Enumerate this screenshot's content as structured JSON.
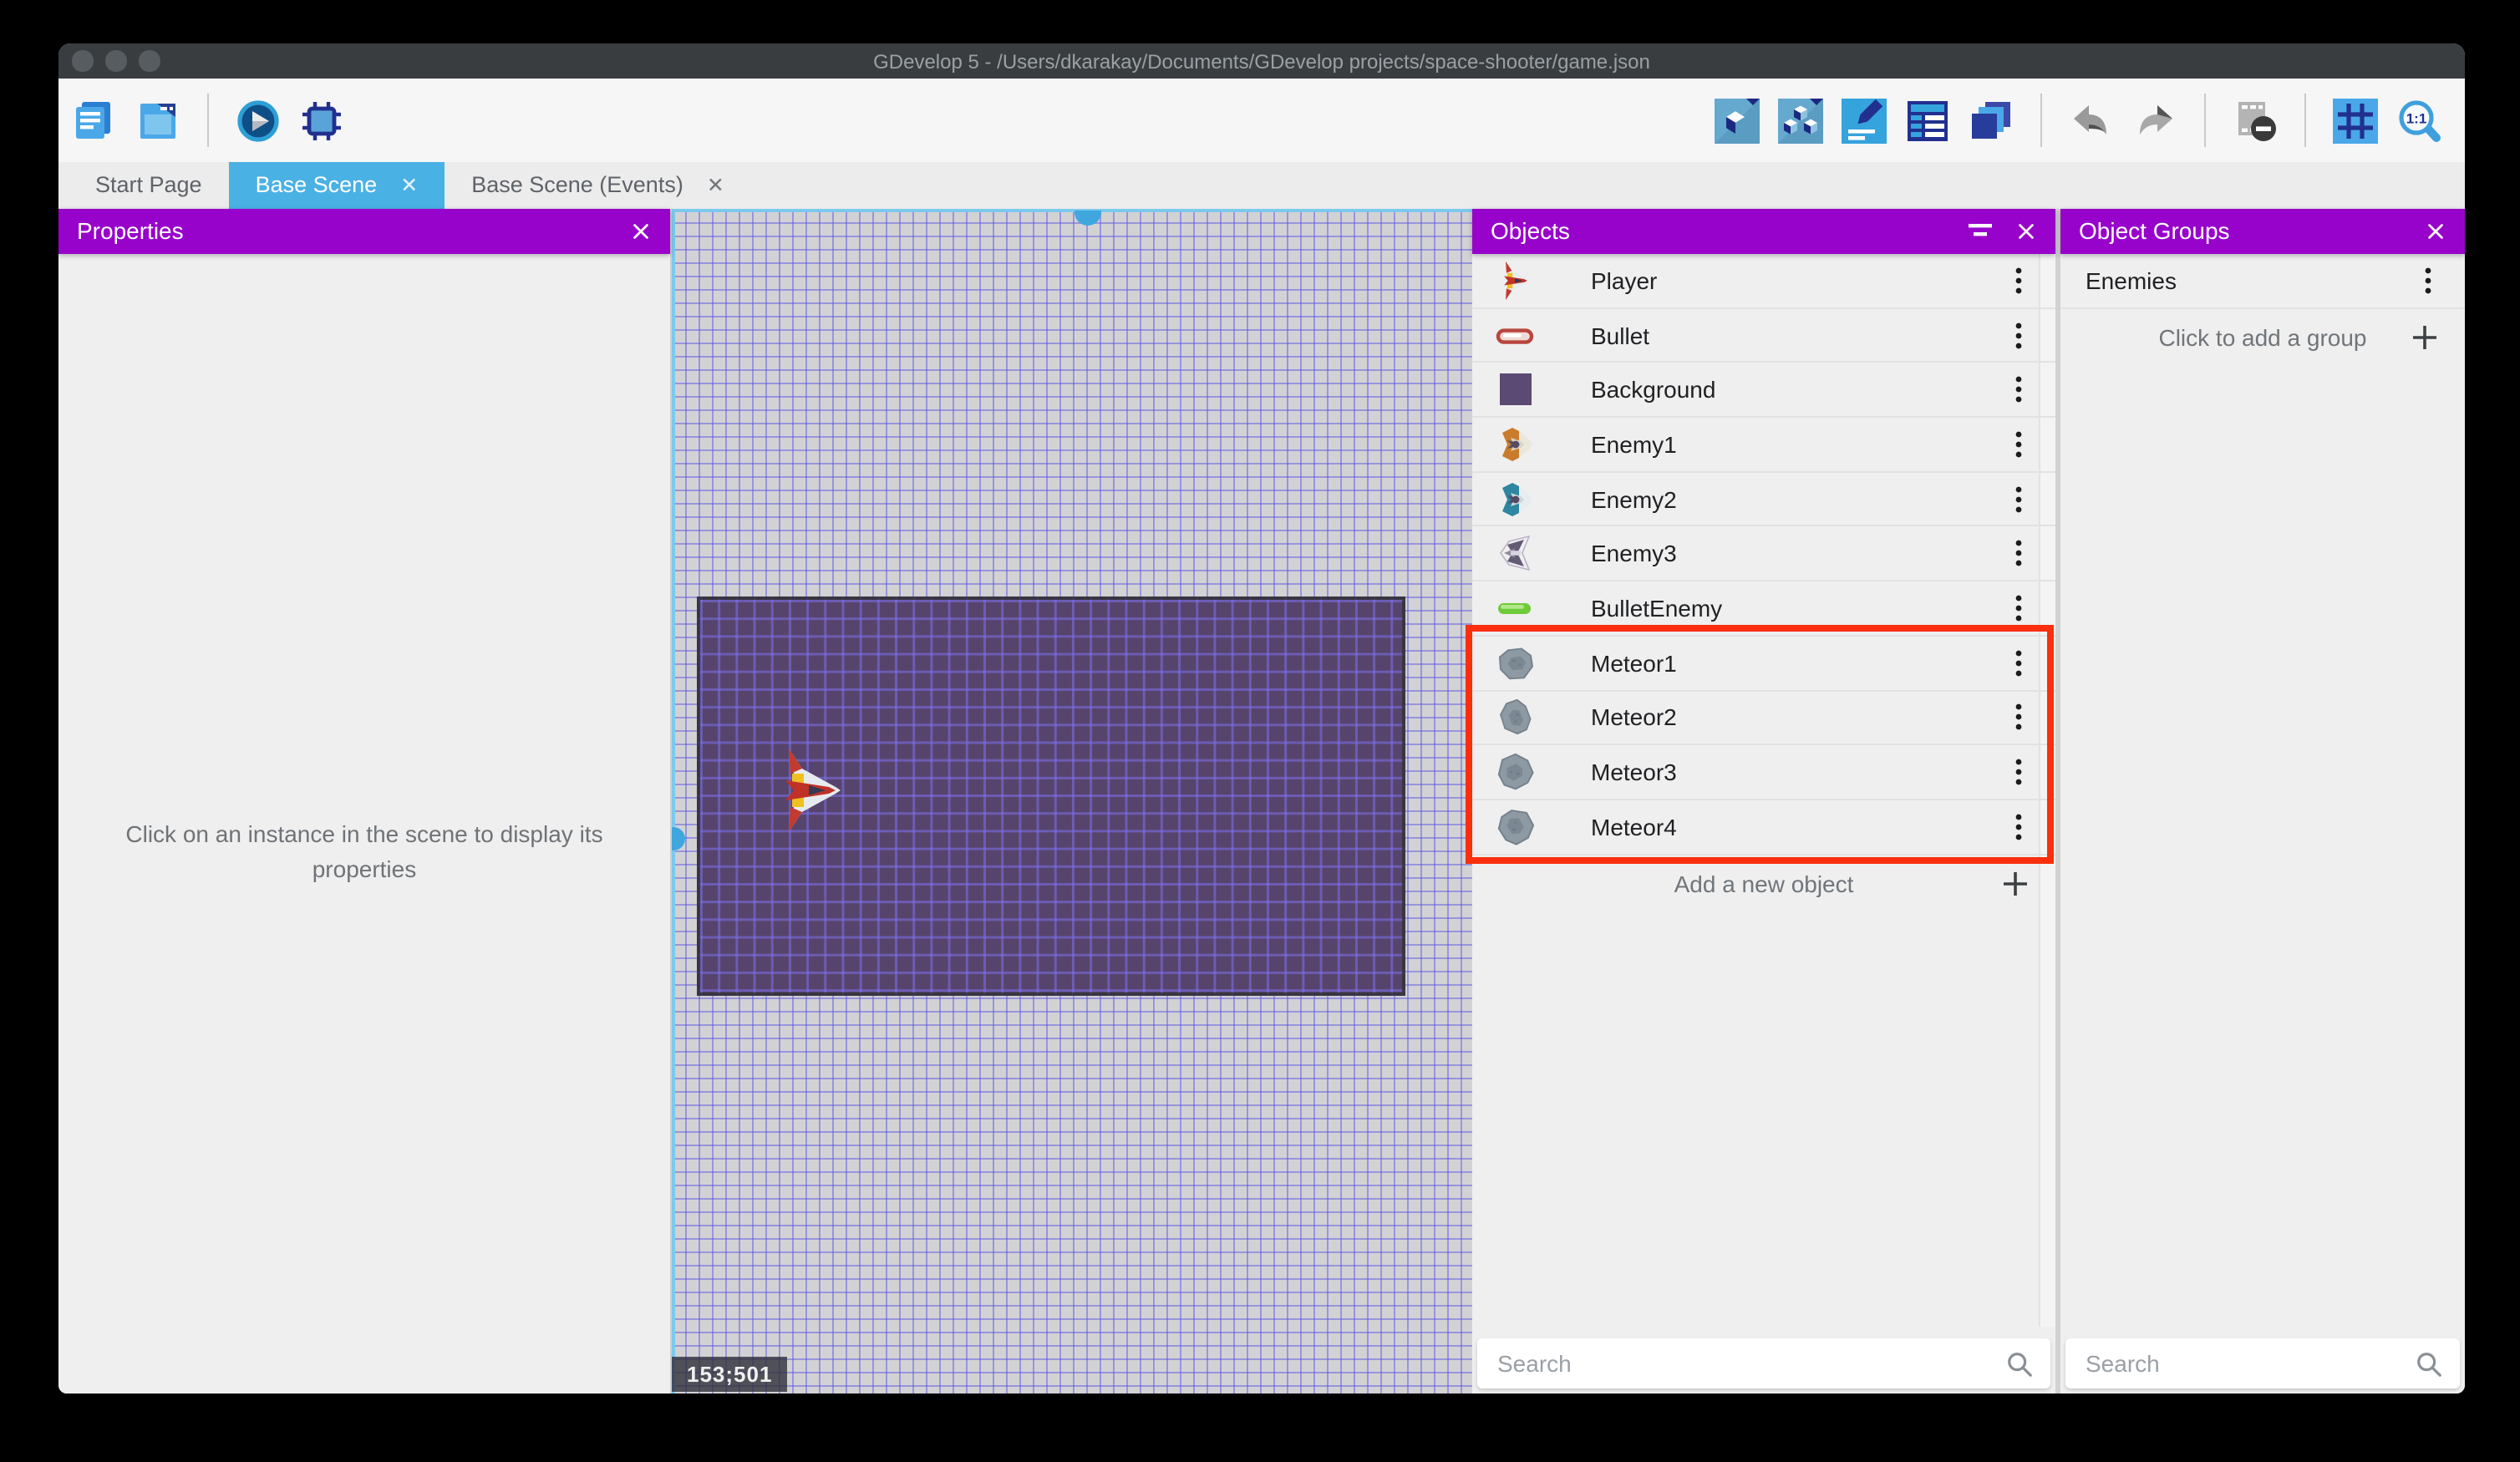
{
  "window": {
    "title": "GDevelop 5 - /Users/dkarakay/Documents/GDevelop projects/space-shooter/game.json"
  },
  "toolbar": {
    "left_icons": [
      {
        "name": "project-manager-icon"
      },
      {
        "name": "scene-window-icon"
      },
      {
        "name": "divider"
      },
      {
        "name": "play-icon"
      },
      {
        "name": "debug-icon"
      }
    ],
    "right_icons": [
      {
        "name": "objects-panel-icon"
      },
      {
        "name": "object-groups-panel-icon"
      },
      {
        "name": "edit-scene-properties-icon"
      },
      {
        "name": "instances-list-icon"
      },
      {
        "name": "layers-icon"
      },
      {
        "name": "divider"
      },
      {
        "name": "undo-icon"
      },
      {
        "name": "redo-icon"
      },
      {
        "name": "divider"
      },
      {
        "name": "deselect-instances-icon"
      },
      {
        "name": "divider"
      },
      {
        "name": "grid-icon"
      },
      {
        "name": "zoom-1-1-icon"
      }
    ]
  },
  "tabs": [
    {
      "label": "Start Page",
      "active": false,
      "closable": false
    },
    {
      "label": "Base Scene",
      "active": true,
      "closable": true
    },
    {
      "label": "Base Scene (Events)",
      "active": false,
      "closable": true
    }
  ],
  "properties_panel": {
    "title": "Properties",
    "message": "Click on an instance in the scene to display its properties"
  },
  "scene": {
    "cursor_coordinates": "153;501"
  },
  "objects_panel": {
    "title": "Objects",
    "add_label": "Add a new object",
    "search_placeholder": "Search",
    "objects": [
      {
        "name": "Player",
        "icon": "player-ship"
      },
      {
        "name": "Bullet",
        "icon": "bullet"
      },
      {
        "name": "Background",
        "icon": "background-square"
      },
      {
        "name": "Enemy1",
        "icon": "enemy1-ship"
      },
      {
        "name": "Enemy2",
        "icon": "enemy2-ship"
      },
      {
        "name": "Enemy3",
        "icon": "enemy3-ship"
      },
      {
        "name": "BulletEnemy",
        "icon": "bullet-enemy"
      },
      {
        "name": "Meteor1",
        "icon": "meteor-1"
      },
      {
        "name": "Meteor2",
        "icon": "meteor-2"
      },
      {
        "name": "Meteor3",
        "icon": "meteor-3"
      },
      {
        "name": "Meteor4",
        "icon": "meteor-4"
      }
    ],
    "highlighted_objects": [
      "Meteor1",
      "Meteor2",
      "Meteor3",
      "Meteor4"
    ]
  },
  "object_groups_panel": {
    "title": "Object Groups",
    "groups": [
      {
        "name": "Enemies"
      }
    ],
    "add_label": "Click to add a group",
    "search_placeholder": "Search"
  },
  "colors": {
    "accent_blue": "#4ab1e4",
    "header_purple": "#9803cb",
    "highlight_red": "#f92f0d",
    "selection_blue": "#3fa7de",
    "titlebar_dark": "#393d40",
    "scene_background_purple": "#57446c"
  }
}
